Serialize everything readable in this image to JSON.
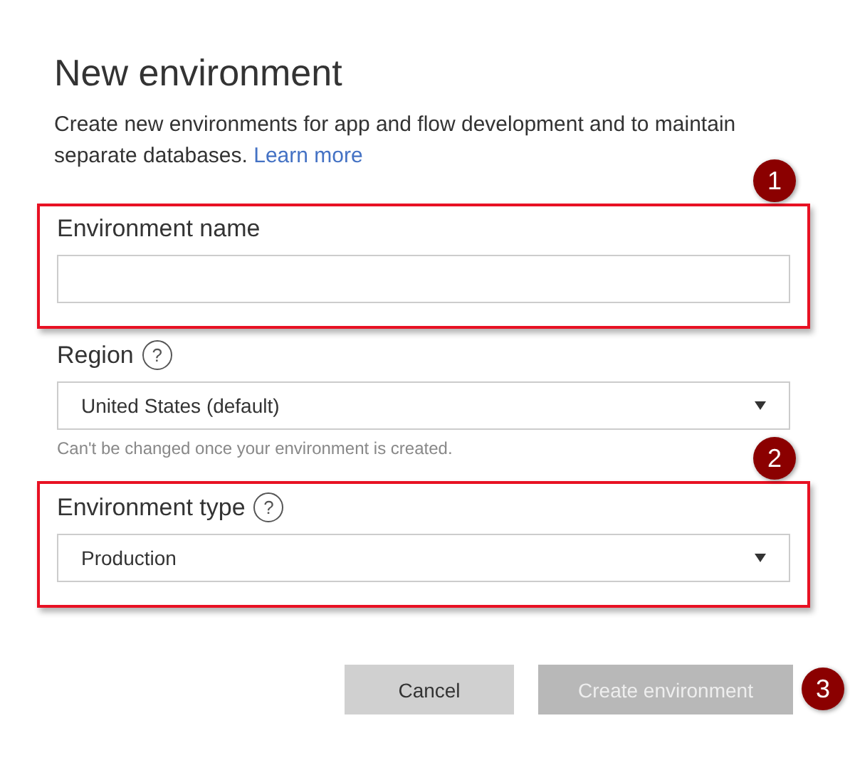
{
  "title": "New environment",
  "description": {
    "text": "Create new environments for app and flow development and to maintain separate databases.",
    "link": "Learn more"
  },
  "fields": [
    {
      "kind": "text",
      "label": "Environment name",
      "highlighted": true,
      "annotation": "1"
    },
    {
      "kind": "select",
      "label": "Region",
      "help": "?",
      "highlighted": false,
      "value": "United States (default)",
      "hint": "Can't be changed once your environment is created."
    },
    {
      "kind": "select",
      "label": "Environment type",
      "help": "?",
      "highlighted": true,
      "annotation": "2",
      "value": "Production"
    }
  ],
  "buttons": [
    {
      "label": "Cancel",
      "disabled": false
    },
    {
      "label": "Create environment",
      "disabled": true,
      "annotation": "3"
    }
  ]
}
